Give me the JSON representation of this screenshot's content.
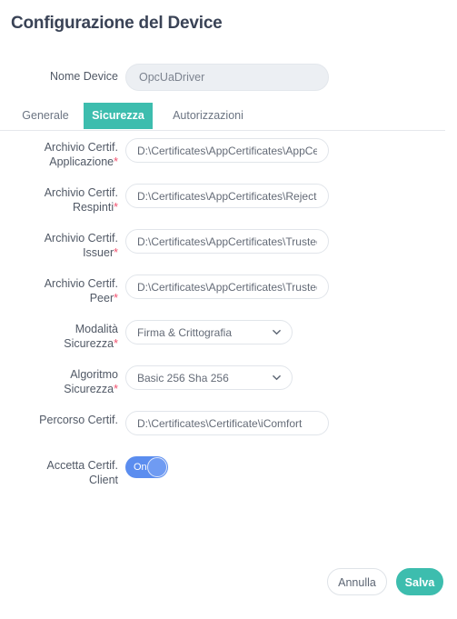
{
  "page": {
    "title": "Configurazione del Device"
  },
  "device": {
    "label": "Nome Device",
    "value": "OpcUaDriver",
    "placeholder": "Nome Device"
  },
  "tabs": [
    {
      "id": "generale",
      "label": "Generale",
      "active": false
    },
    {
      "id": "sicurezza",
      "label": "Sicurezza",
      "active": true
    },
    {
      "id": "autorizzazioni",
      "label": "Autorizzazioni",
      "active": false
    }
  ],
  "form": {
    "fields": [
      {
        "id": "archivio-certif-applicazione",
        "label_line1": "Archivio Certif.",
        "label_line2": "Applicazione",
        "required": true,
        "type": "text",
        "value": "D:\\Certificates\\AppCertificates\\AppCertificate",
        "placeholder": "Archivio Certif. Applicazione"
      },
      {
        "id": "archivio-certif-respinti",
        "label_line1": "Archivio Certif.",
        "label_line2": "Respinti",
        "required": true,
        "type": "text",
        "value": "D:\\Certificates\\AppCertificates\\RejectedCertificates",
        "placeholder": "Archivio Certif. Respinti"
      },
      {
        "id": "archivio-certif-issuer",
        "label_line1": "Archivio Certif.",
        "label_line2": "Issuer",
        "required": true,
        "type": "text",
        "value": "D:\\Certificates\\AppCertificates\\TrustedIssuerCertificates",
        "placeholder": "Archivio Certif. Issuer"
      },
      {
        "id": "archivio-certif-peer",
        "label_line1": "Archivio Certif.",
        "label_line2": "Peer",
        "required": true,
        "type": "text",
        "value": "D:\\Certificates\\AppCertificates\\TrustedPeerCertificates",
        "placeholder": "Archivio Certif. Peer"
      },
      {
        "id": "modalita-sicurezza",
        "label_line1": "Modalità",
        "label_line2": "Sicurezza",
        "required": true,
        "type": "select",
        "value": "Firma & Crittografia",
        "options": [
          "Firma & Crittografia"
        ]
      },
      {
        "id": "algoritmo-sicurezza",
        "label_line1": "Algoritmo",
        "label_line2": "Sicurezza",
        "required": true,
        "type": "select",
        "value": "Basic 256 Sha 256",
        "options": [
          "Basic 256 Sha 256"
        ]
      },
      {
        "id": "percorso-certif",
        "label_line1": "Percorso Certif.",
        "label_line2": "",
        "required": false,
        "type": "text",
        "value": "D:\\Certificates\\Certificate\\iComfort",
        "placeholder": "Percorso Certif."
      },
      {
        "id": "accetta-certif-client",
        "label_line1": "Accetta Certif.",
        "label_line2": "Client",
        "required": false,
        "type": "toggle",
        "value": "On"
      }
    ],
    "required_marker": "*"
  },
  "footer": {
    "cancel_label": "Annulla",
    "save_label": "Salva"
  },
  "colors": {
    "accent_teal": "#3dbdae",
    "toggle_blue": "#5b8def",
    "required_red": "#f2506e",
    "title": "#3a4356"
  }
}
